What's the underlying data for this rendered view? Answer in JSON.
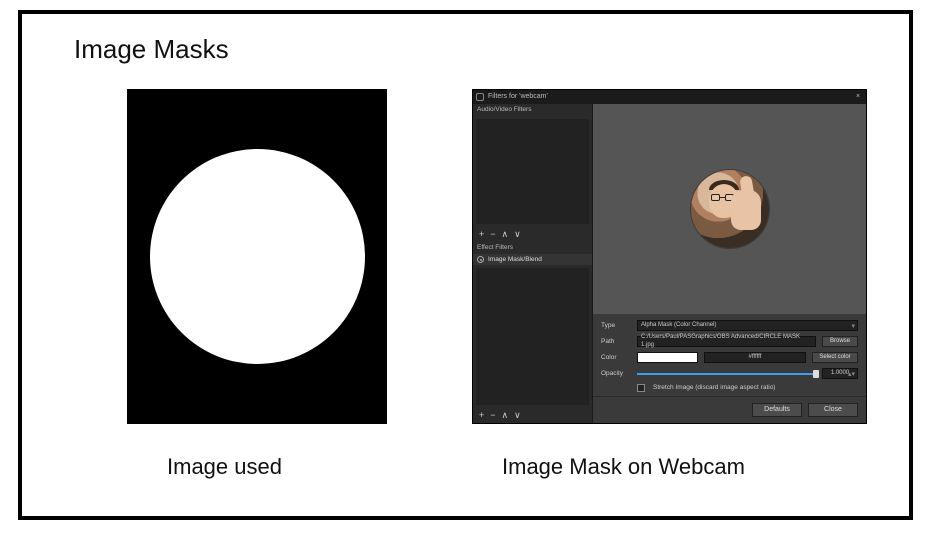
{
  "page": {
    "title": "Image Masks",
    "caption_left": "Image used",
    "caption_right": "Image Mask on Webcam"
  },
  "dialog": {
    "title": "Filters for 'webcam'",
    "close_glyph": "×",
    "left_panel": {
      "audio_video_label": "Audio/Video Filters",
      "effect_label": "Effect Filters",
      "selected_filter": "Image Mask/Blend",
      "add_glyph": "+",
      "remove_glyph": "−",
      "up_glyph": "∧",
      "down_glyph": "∨"
    },
    "properties": {
      "type_label": "Type",
      "type_value": "Alpha Mask (Color Channel)",
      "path_label": "Path",
      "path_value": "C:/Users/Paul/PASGraphics/OBS Advanced/CIRCLE MASK 1.jpg",
      "browse_label": "Browse",
      "color_label": "Color",
      "color_value": "#ffffff",
      "color_hex_display": "#ffffff",
      "select_color_label": "Select color",
      "opacity_label": "Opacity",
      "opacity_value": "1.0000",
      "stretch_label": "Stretch Image (discard image aspect ratio)"
    },
    "footer": {
      "defaults_label": "Defaults",
      "close_label": "Close"
    }
  }
}
